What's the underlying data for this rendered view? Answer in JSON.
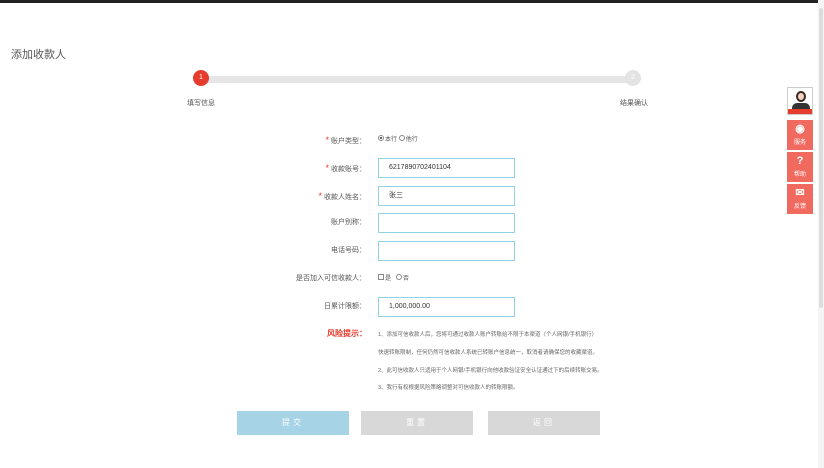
{
  "page": {
    "title": "添加收款人"
  },
  "steps": [
    {
      "num": "1",
      "label": "填写信息",
      "active": true
    },
    {
      "num": "2",
      "label": "结果确认",
      "active": false
    }
  ],
  "form": {
    "account_type": {
      "label": "账户类型：",
      "required": true,
      "options": [
        "本行",
        "他行"
      ],
      "selected": "本行"
    },
    "account_no": {
      "label": "收款账号：",
      "required": true,
      "value": "6217890702401104"
    },
    "payee_name": {
      "label": "收款人姓名：",
      "required": true,
      "value": "张三"
    },
    "alias": {
      "label": "账户别称：",
      "required": false,
      "value": ""
    },
    "phone": {
      "label": "电话号码：",
      "required": false,
      "value": ""
    },
    "trusted": {
      "label": "是否加入可信收款人：",
      "options": [
        "是",
        "否"
      ],
      "selected": "是"
    },
    "daily_limit": {
      "label": "日累计限额：",
      "value": "1,000,000.00"
    }
  },
  "risk": {
    "title": "风险提示：",
    "lines": [
      "1、添加可信收款人后，您将可通过收款人账户转账给不限于本渠道（个人网银/手机银行）",
      "快速转账限制，任何仍然可信收款人系统已转账户信息统一，取消者请确保您的收藏渠道。",
      "2、此可信收款人只适用于个人网银/手机银行向他收款验证安全认证通过下的后续转账交易。",
      "3、我行有权根据风险策略调整对可信收款人的转账限额。"
    ]
  },
  "buttons": {
    "submit": "提交",
    "reset": "重置",
    "back": "返回"
  },
  "sidebar": {
    "avatar_label": "客服",
    "items": [
      {
        "label": "服务",
        "icon": "eye-icon"
      },
      {
        "label": "帮助",
        "icon": "question-icon"
      },
      {
        "label": "反馈",
        "icon": "mail-icon"
      }
    ]
  },
  "colors": {
    "accent": "#e63c2e",
    "input_border": "#8fd3e0",
    "submit_bg": "#a6d3e6",
    "side_bg": "#f06a5f"
  }
}
